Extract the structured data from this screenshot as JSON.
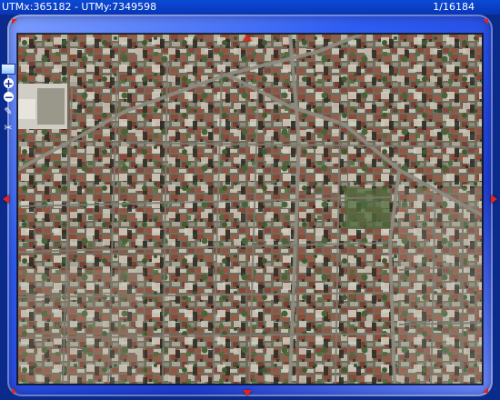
{
  "status": {
    "coordinates": "UTMx:365182 - UTMy:7349598",
    "scale": "1/16184"
  },
  "navigation": {
    "pan_up": "▲",
    "pan_down": "▼",
    "pan_left": "◀",
    "pan_right": "▶"
  },
  "toolbar": {
    "tools": [
      {
        "name": "layers",
        "icon": "layers-icon"
      },
      {
        "name": "zoom-in",
        "icon": "zoom-in-icon",
        "glyph": "+"
      },
      {
        "name": "zoom-out",
        "icon": "zoom-out-icon",
        "glyph": "−"
      },
      {
        "name": "pencil",
        "icon": "pencil-icon",
        "glyph": "✎"
      },
      {
        "name": "measure",
        "icon": "measure-icon",
        "glyph": "✂"
      }
    ]
  },
  "colors": {
    "frame_blue": "#1e3fd2",
    "topbar_blue": "#0836b6",
    "arrow_red": "#e4231a",
    "urban_base": "#6c6a59"
  }
}
